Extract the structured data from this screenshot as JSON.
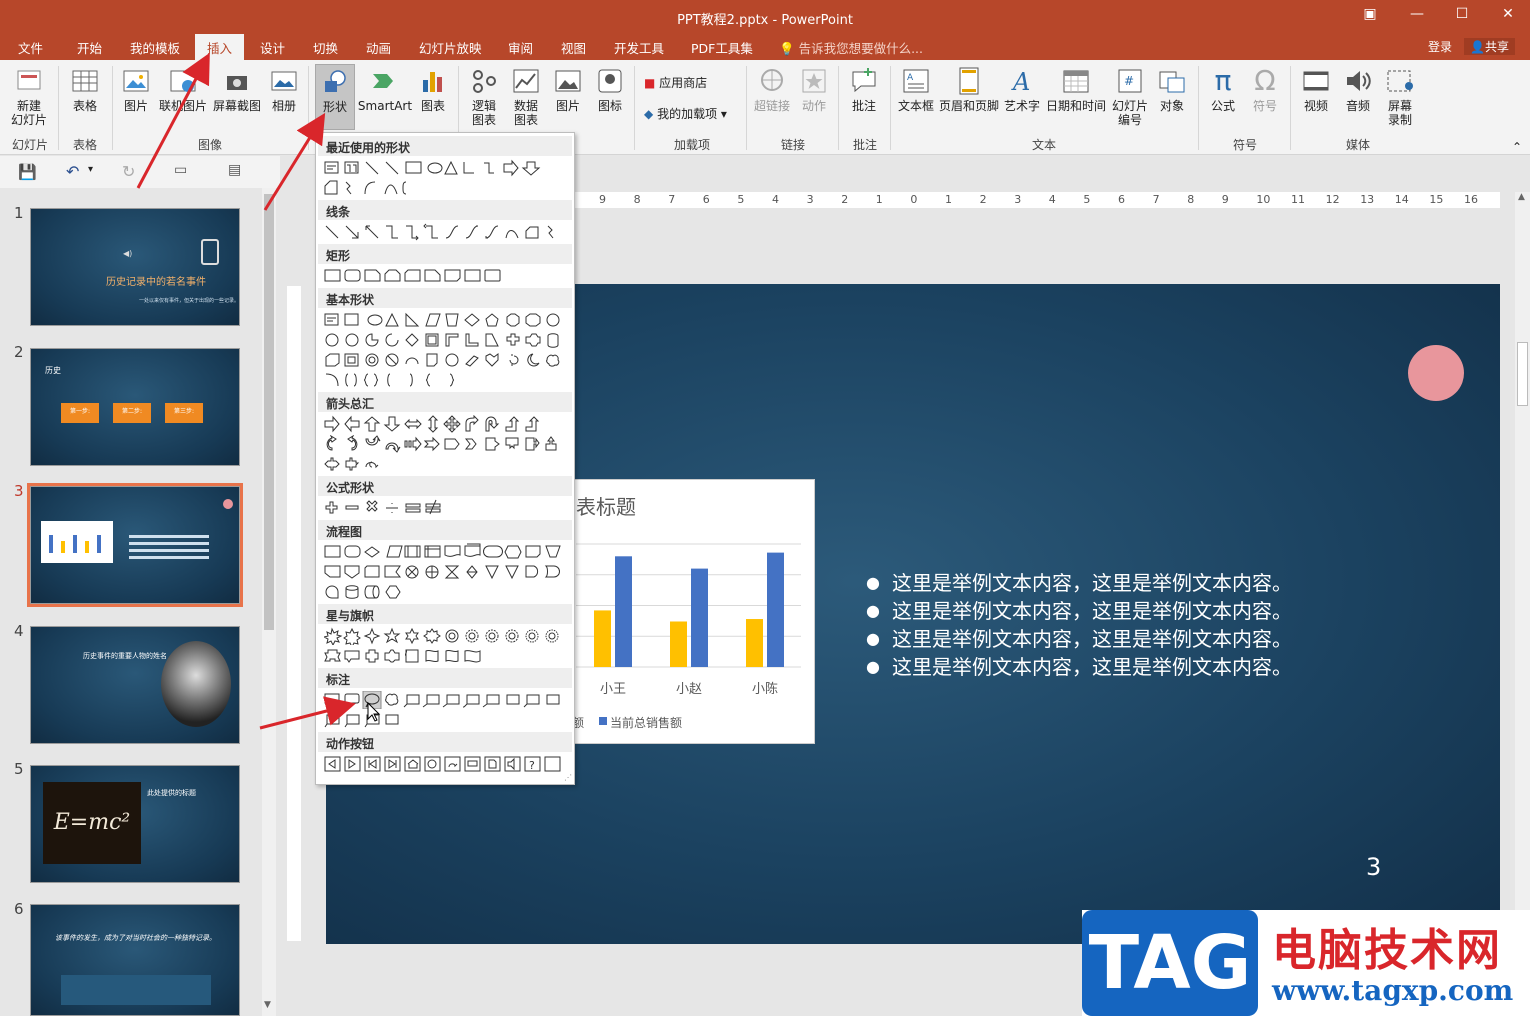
{
  "window": {
    "title": "PPT教程2.pptx - PowerPoint",
    "controls": [
      "restore-ribbon-icon",
      "minimize-icon",
      "maximize-icon",
      "close-icon"
    ]
  },
  "menu": {
    "tabs": [
      "文件",
      "开始",
      "我的模板",
      "插入",
      "设计",
      "切换",
      "动画",
      "幻灯片放映",
      "审阅",
      "视图",
      "开发工具",
      "PDF工具集"
    ],
    "active_tab": "插入",
    "tell_me": "告诉我您想要做什么...",
    "login": "登录",
    "share": "共享"
  },
  "ribbon": {
    "groups": {
      "slides": "幻灯片",
      "tables": "表格",
      "images": "图像",
      "addins": "加载项",
      "links": "链接",
      "comments": "批注",
      "text": "文本",
      "symbols": "符号",
      "media": "媒体"
    },
    "buttons": {
      "new_slide": [
        "新建",
        "幻灯片"
      ],
      "table": "表格",
      "picture": "图片",
      "online_picture": "联机图片",
      "screenshot": "屏幕截图",
      "album": "相册",
      "shapes": "形状",
      "smartart": "SmartArt",
      "chart": "图表",
      "logic_chart": [
        "逻辑",
        "图表"
      ],
      "data_chart": [
        "数据",
        "图表"
      ],
      "picture2": "图片",
      "icon": "图标",
      "app_store": "应用商店",
      "my_addins": "我的加载项",
      "hyperlink": "超链接",
      "action": "动作",
      "comment": "批注",
      "textbox": "文本框",
      "header_footer": "页眉和页脚",
      "wordart": "艺术字",
      "date_time": "日期和时间",
      "slide_number": [
        "幻灯片",
        "编号"
      ],
      "object": "对象",
      "equation": "公式",
      "symbol": "符号",
      "video": "视频",
      "audio": "音频",
      "screen_record": [
        "屏幕",
        "录制"
      ]
    }
  },
  "shapes_menu": {
    "sections": [
      "最近使用的形状",
      "线条",
      "矩形",
      "基本形状",
      "箭头总汇",
      "公式形状",
      "流程图",
      "星与旗帜",
      "标注",
      "动作按钮"
    ]
  },
  "thumbnails": [
    {
      "num": "1",
      "title": "历史记录中的若名事件",
      "subtitle": "一处以来仅有事件，但关于出现的一些记录。"
    },
    {
      "num": "2",
      "label": "历史",
      "steps": [
        "第一步:",
        "第二步:",
        "第三步:"
      ]
    },
    {
      "num": "3",
      "selected": true
    },
    {
      "num": "4",
      "title": "历史事件的重要人物的姓名"
    },
    {
      "num": "5",
      "title": "此处提供的标题",
      "formula": "E=mc²"
    },
    {
      "num": "6",
      "quote": "该事件的发生，成为了对当时社会的一种独特记录。"
    }
  ],
  "ruler": {
    "labels": [
      "9",
      "8",
      "7",
      "6",
      "5",
      "4",
      "3",
      "2",
      "1",
      "0",
      "1",
      "2",
      "3",
      "4",
      "5",
      "6",
      "7",
      "8",
      "9",
      "10",
      "11",
      "12",
      "13",
      "14",
      "15",
      "16"
    ]
  },
  "slide": {
    "chart_title": "表标题",
    "bullets": [
      "这里是举例文本内容，这里是举例文本内容。",
      "这里是举例文本内容，这里是举例文本内容。",
      "这里是举例文本内容，这里是举例文本内容。",
      "这里是举例文本内容，这里是举例文本内容。"
    ],
    "number": "3",
    "accent_color": "#e8969c"
  },
  "chart_data": {
    "type": "bar",
    "title": "表标题",
    "categories": [
      "小王",
      "小赵",
      "小陈"
    ],
    "series": [
      {
        "name": "",
        "values": [
          46,
          37,
          39
        ],
        "color": "#ffc000"
      },
      {
        "name": "当前总销售额",
        "values": [
          90,
          80,
          93
        ],
        "color": "#4472c4"
      }
    ],
    "legend_visible": [
      "额",
      "当前总销售额"
    ],
    "ylim": [
      0,
      100
    ]
  },
  "watermark": {
    "tag": "TAG",
    "cn": "电脑技术网",
    "url": "www.tagxp.com"
  },
  "colors": {
    "title_bar": "#b7472a",
    "ribbon": "#f3f3f3",
    "selection": "#e8734a",
    "annotation_arrow": "#d9262b"
  }
}
